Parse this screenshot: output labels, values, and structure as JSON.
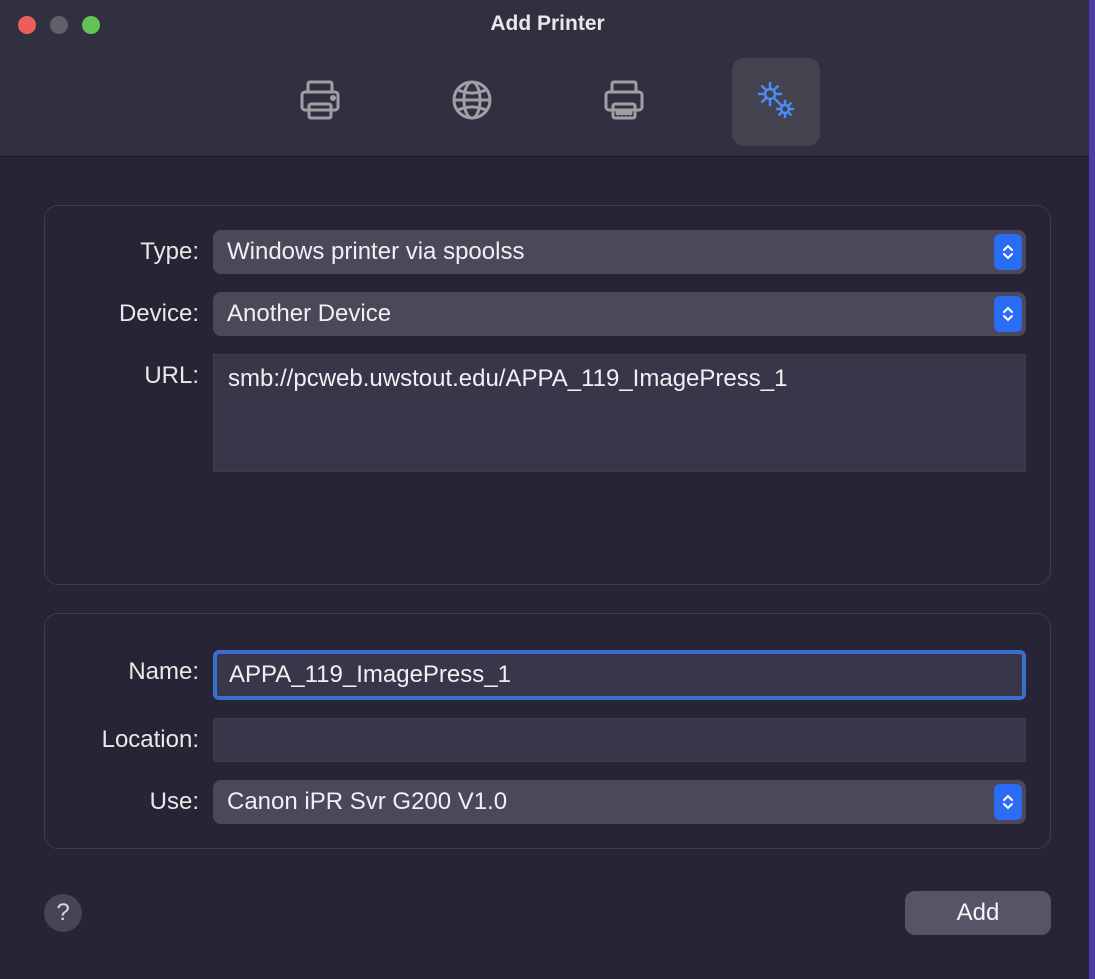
{
  "window": {
    "title": "Add Printer"
  },
  "toolbar": {
    "tabs": [
      "default-printer",
      "ip-printer",
      "windows-printer",
      "advanced"
    ],
    "active_index": 3
  },
  "form_top": {
    "type_label": "Type:",
    "type_value": "Windows printer via spoolss",
    "device_label": "Device:",
    "device_value": "Another Device",
    "url_label": "URL:",
    "url_value": "smb://pcweb.uwstout.edu/APPA_119_ImagePress_1"
  },
  "form_bottom": {
    "name_label": "Name:",
    "name_value": "APPA_119_ImagePress_1",
    "location_label": "Location:",
    "location_value": "",
    "use_label": "Use:",
    "use_value": "Canon iPR Svr G200 V1.0"
  },
  "footer": {
    "help_label": "?",
    "add_label": "Add"
  }
}
